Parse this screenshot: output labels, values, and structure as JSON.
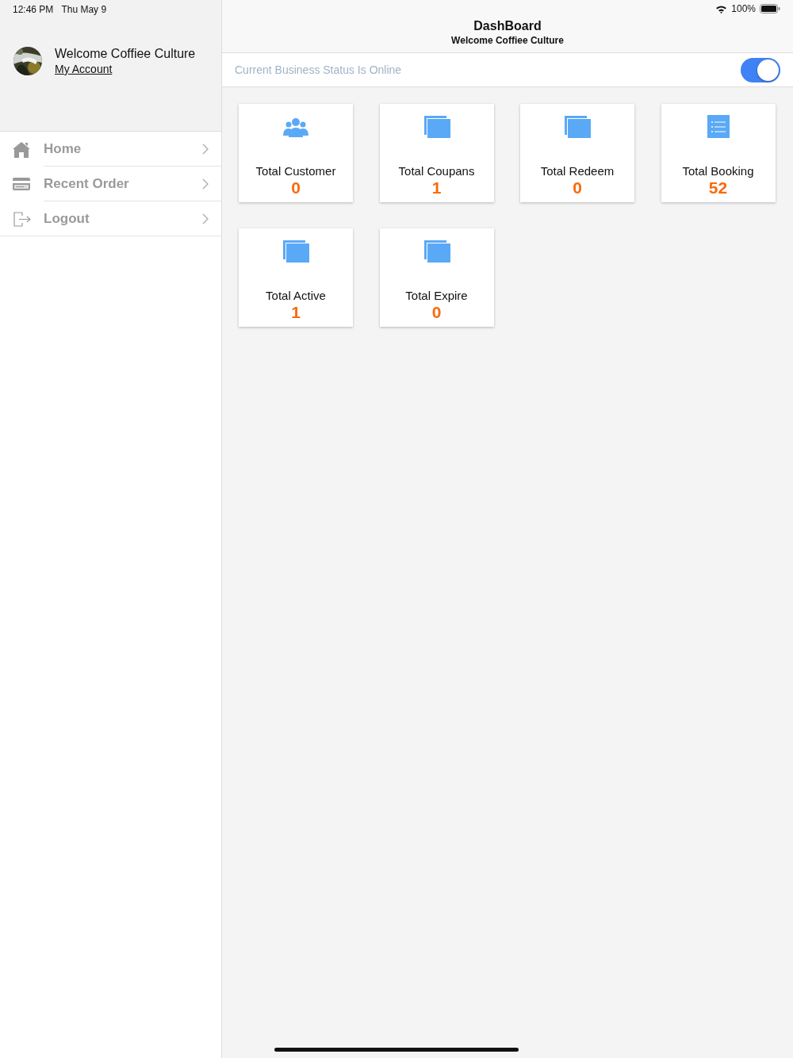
{
  "status_bar": {
    "time": "12:46 PM",
    "date": "Thu May 9",
    "battery": "100%"
  },
  "sidebar": {
    "profile": {
      "name": "Welcome Coffiee Culture",
      "link": "My Account"
    },
    "items": [
      {
        "label": "Home",
        "kind": "home"
      },
      {
        "label": "Recent Order",
        "kind": "card"
      },
      {
        "label": "Logout",
        "kind": "logout"
      }
    ]
  },
  "nav": {
    "title": "DashBoard",
    "subtitle": "Welcome Coffiee Culture"
  },
  "business_status": {
    "label": "Current Business Status Is Online",
    "on": true
  },
  "cards": [
    {
      "title": "Total Customer",
      "value": "0",
      "kind": "people"
    },
    {
      "title": "Total Coupans",
      "value": "1",
      "kind": "pages"
    },
    {
      "title": "Total Redeem",
      "value": "0",
      "kind": "pages"
    },
    {
      "title": "Total Booking",
      "value": "52",
      "kind": "list"
    },
    {
      "title": "Total Active",
      "value": "1",
      "kind": "pages"
    },
    {
      "title": "Total Expire",
      "value": "0",
      "kind": "pages"
    }
  ]
}
